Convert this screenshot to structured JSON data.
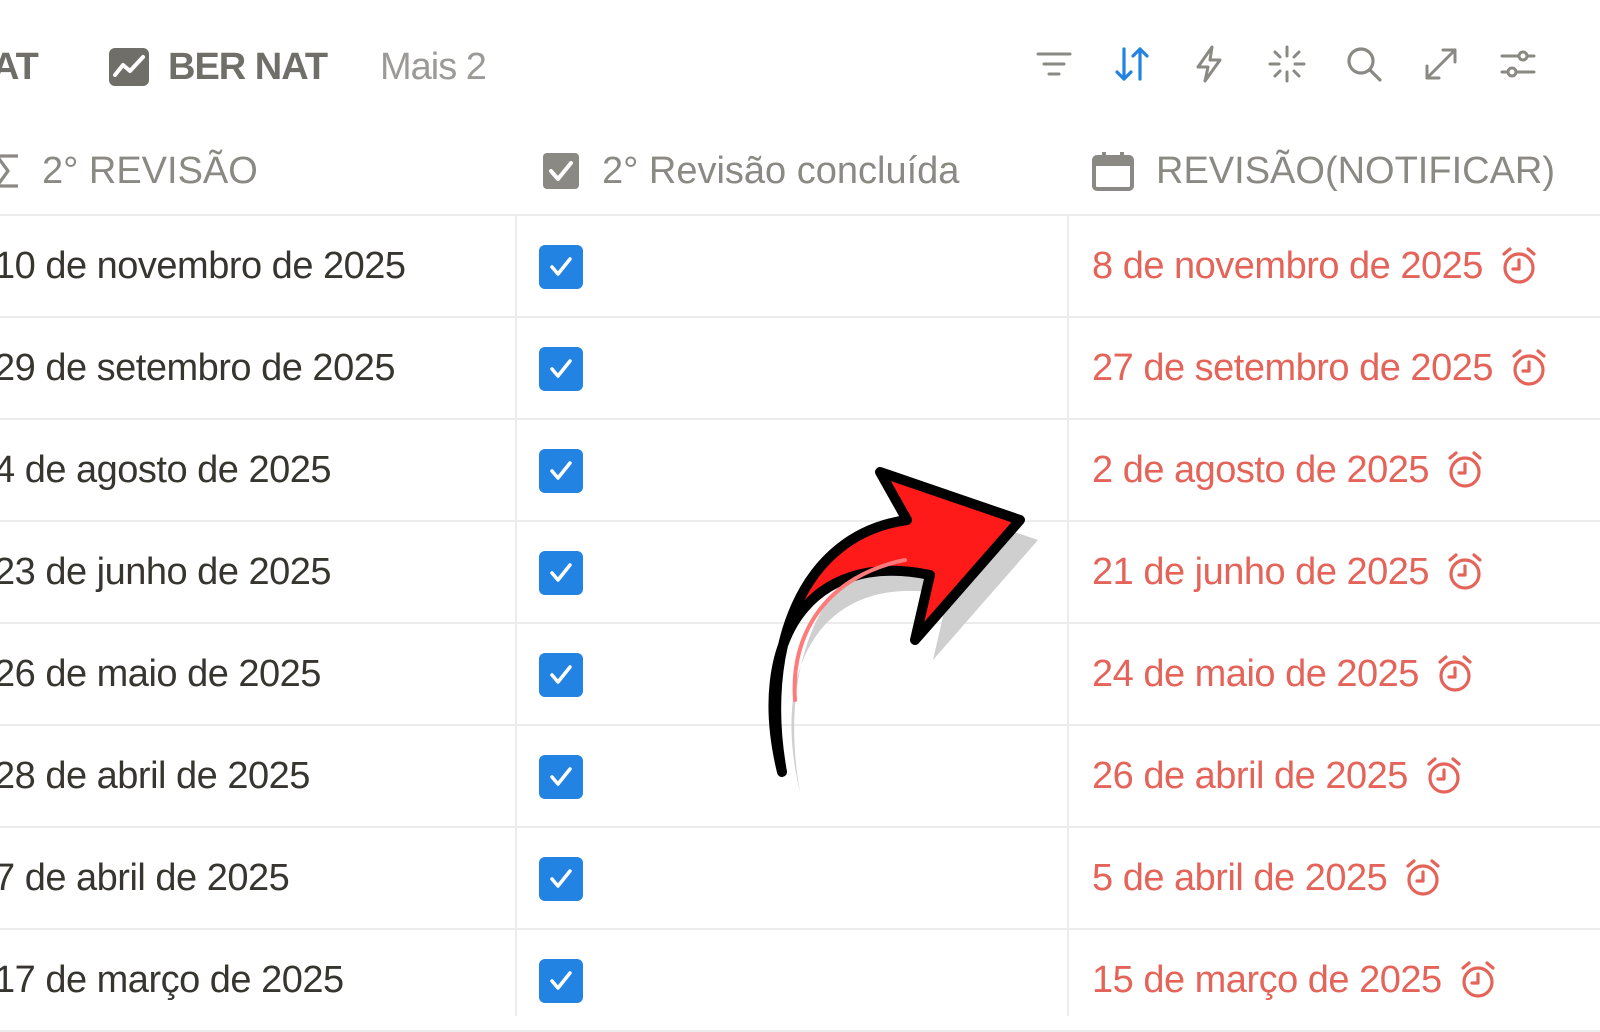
{
  "toolbar": {
    "tabs": [
      {
        "label": "AT"
      },
      {
        "label": "BER NAT",
        "icon": "chart-line-icon"
      },
      {
        "label": "Mais 2"
      }
    ],
    "tools": [
      "filter-icon",
      "sort-icon",
      "automation-bolt-icon",
      "ai-sparkle-icon",
      "search-icon",
      "expand-icon",
      "settings-sliders-icon"
    ],
    "active_tool_color": "#2383e2"
  },
  "table": {
    "columns": [
      {
        "label": "2° REVISÃO",
        "icon": "sigma-formula-icon"
      },
      {
        "label": "2° Revisão concluída",
        "icon": "checkbox-icon"
      },
      {
        "label": "REVISÃO(NOTIFICAR)",
        "icon": "calendar-icon"
      }
    ],
    "rows": [
      {
        "review2": "10 de novembro de 2025",
        "done": true,
        "notify": "8 de novembro de 2025"
      },
      {
        "review2": "29 de setembro de 2025",
        "done": true,
        "notify": "27 de setembro de 2025"
      },
      {
        "review2": "4 de agosto de 2025",
        "done": true,
        "notify": "2 de agosto de 2025"
      },
      {
        "review2": "23 de junho de 2025",
        "done": true,
        "notify": "21 de junho de 2025"
      },
      {
        "review2": "26 de maio de 2025",
        "done": true,
        "notify": "24 de maio de 2025"
      },
      {
        "review2": "28 de abril de 2025",
        "done": true,
        "notify": "26 de abril de 2025"
      },
      {
        "review2": "7 de abril de 2025",
        "done": true,
        "notify": "5 de abril de 2025"
      },
      {
        "review2": "17 de março de 2025",
        "done": true,
        "notify": "15 de março de 2025"
      }
    ],
    "notify_color": "#e5645a",
    "checkbox_color": "#2383e2"
  },
  "overlay": {
    "arrow": "curved-red-arrow-icon",
    "arrow_color": "#ff1a1a"
  }
}
